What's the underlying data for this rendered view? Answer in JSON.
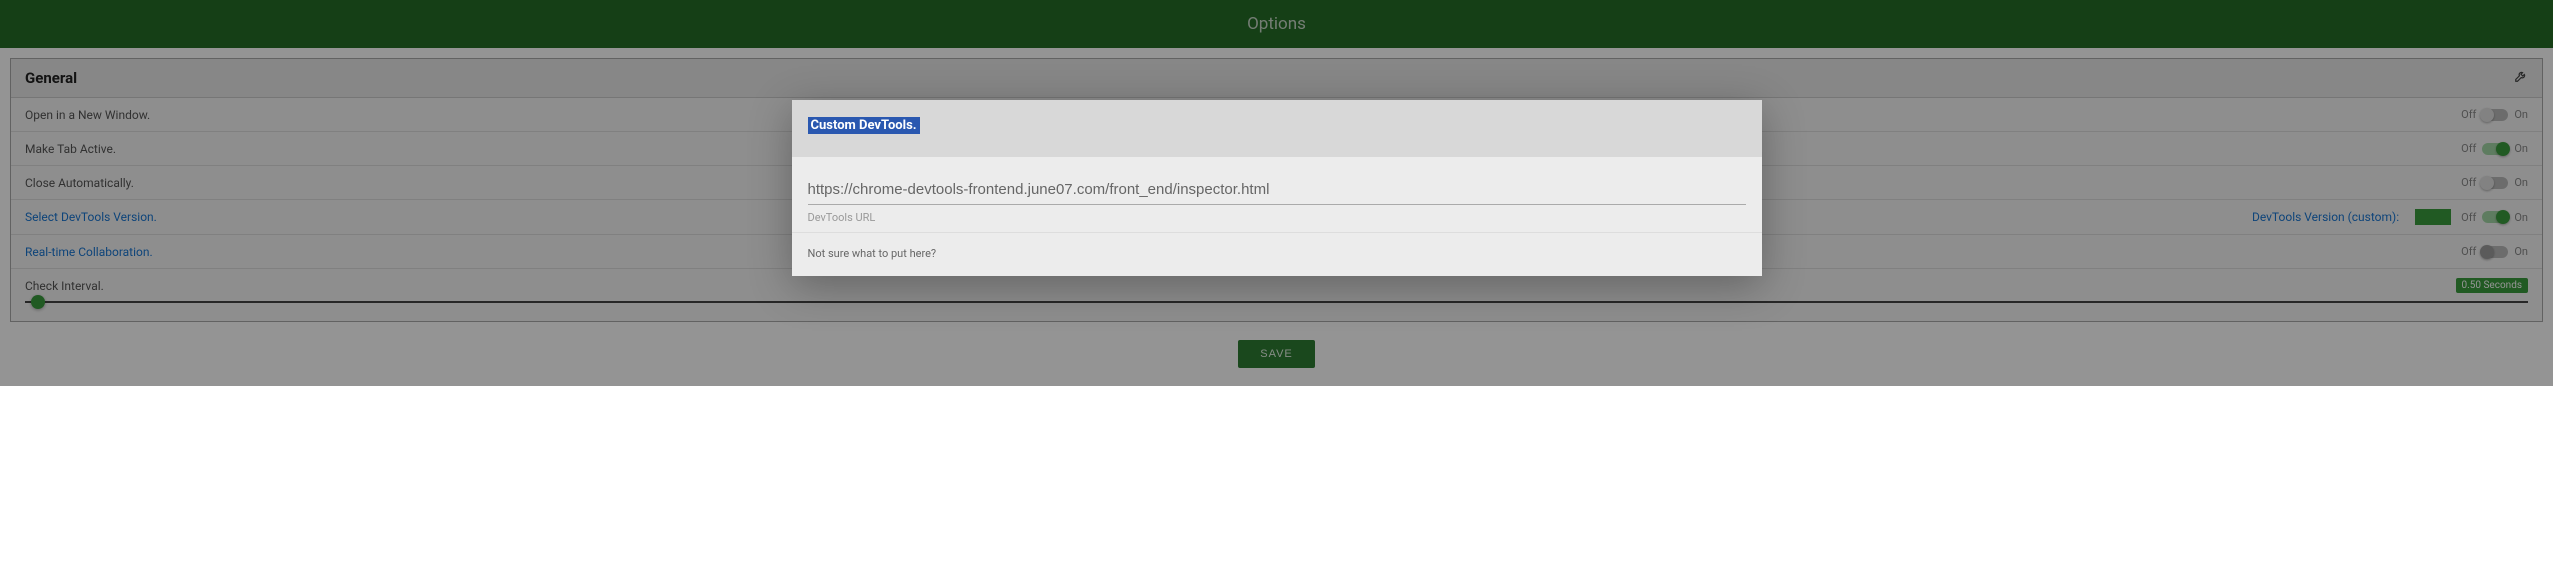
{
  "header": {
    "title": "Options"
  },
  "section": {
    "title": "General",
    "wrench_icon": "wrench"
  },
  "rows": {
    "open_new_window": {
      "label": "Open in a New Window.",
      "off": "Off",
      "on": "On",
      "state": "off"
    },
    "make_tab_active": {
      "label": "Make Tab Active.",
      "off": "Off",
      "on": "On",
      "state": "on"
    },
    "close_automatically": {
      "label": "Close Automatically.",
      "off": "Off",
      "on": "On",
      "state": "off"
    },
    "select_devtools": {
      "label": "Select DevTools Version.",
      "version_label": "DevTools Version (custom):",
      "off": "Off",
      "on": "On",
      "state": "on"
    },
    "realtime_collab": {
      "label": "Real-time Collaboration.",
      "off": "Off",
      "on": "On",
      "state": "off-disabled"
    },
    "check_interval": {
      "label": "Check Interval.",
      "badge": "0.50 Seconds"
    }
  },
  "save": {
    "label": "SAVE"
  },
  "modal": {
    "title": "Custom DevTools.",
    "url": "https://chrome-devtools-frontend.june07.com/front_end/inspector.html",
    "url_field_label": "DevTools URL",
    "footer_text": "Not sure what to put here?"
  }
}
